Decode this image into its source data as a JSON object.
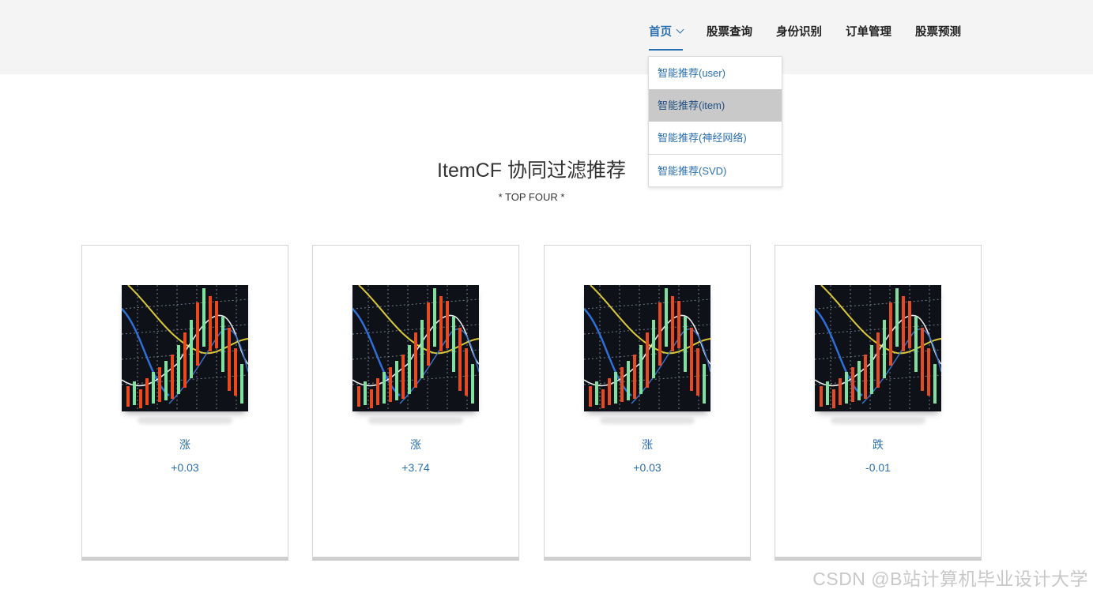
{
  "nav": {
    "items": [
      {
        "label": "首页",
        "active": true,
        "has_dropdown": true
      },
      {
        "label": "股票查询"
      },
      {
        "label": "身份识别"
      },
      {
        "label": "订单管理"
      },
      {
        "label": "股票预测"
      }
    ]
  },
  "dropdown": {
    "items": [
      {
        "label": "智能推荐(user)"
      },
      {
        "label": "智能推荐(item)",
        "hovered": true
      },
      {
        "label": "智能推荐(神经网络)"
      },
      {
        "label": "智能推荐(SVD)"
      }
    ]
  },
  "heading": {
    "title": "ItemCF 协同过滤推荐",
    "subtitle": "* TOP FOUR *"
  },
  "cards": [
    {
      "trend": "涨",
      "change": "+0.03"
    },
    {
      "trend": "涨",
      "change": "+3.74"
    },
    {
      "trend": "涨",
      "change": "+0.03"
    },
    {
      "trend": "跌",
      "change": "-0.01"
    }
  ],
  "icons": {
    "dropdown_chevron": "chevron-down-icon"
  },
  "colors": {
    "accent": "#2a6fb0",
    "topbar_bg": "#f4f4f4",
    "hover_bg": "#c9c9c9"
  },
  "watermark": "CSDN @B站计算机毕业设计大学"
}
